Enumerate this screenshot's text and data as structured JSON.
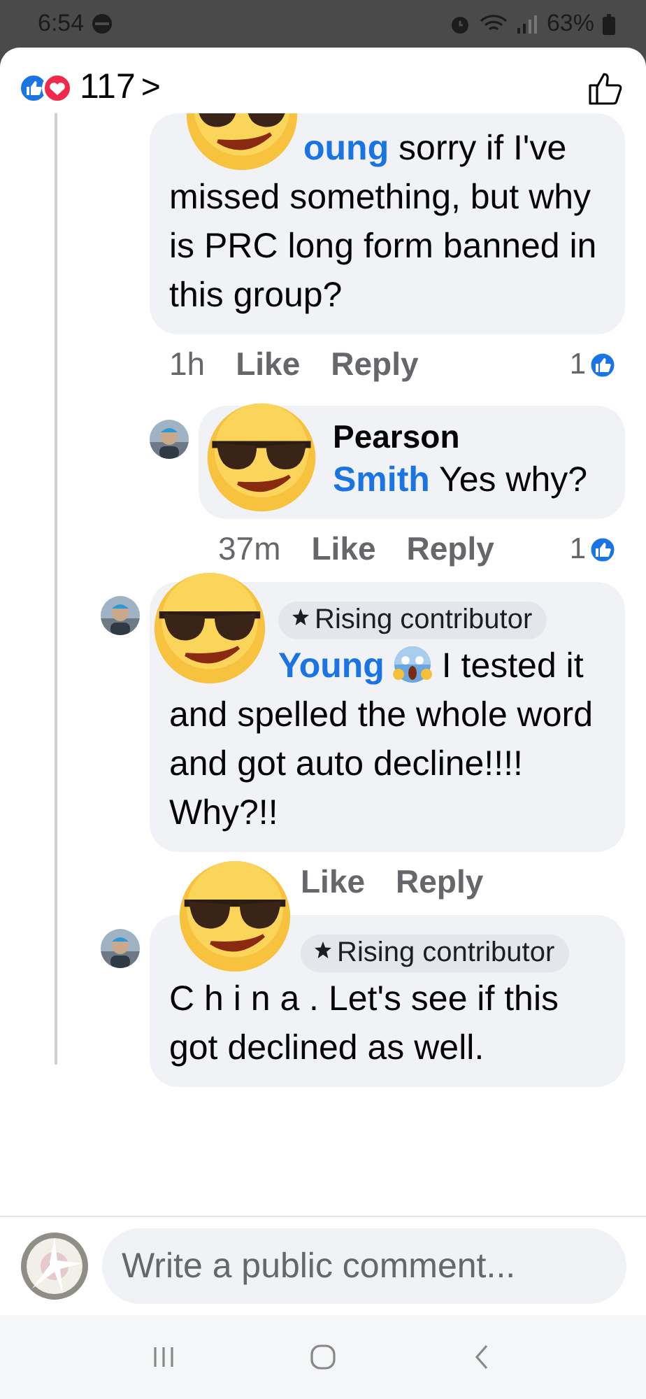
{
  "status_bar": {
    "time": "6:54",
    "battery": "63%"
  },
  "header": {
    "reaction_count": "117",
    "chevron": ">"
  },
  "comments": [
    {
      "sticker": true,
      "body": [
        {
          "kind": "mention",
          "text": "oung"
        },
        {
          "kind": "text",
          "text": " sorry if I've missed something, but why is PRC long form banned in this group?"
        }
      ],
      "meta": {
        "time": "1h",
        "like": "Like",
        "reply": "Reply",
        "reactions": "1"
      },
      "children": [
        {
          "sticker": true,
          "avatar": {
            "kind": "picture"
          },
          "author": "Pearson",
          "body": [
            {
              "kind": "mention",
              "text": "Smith"
            },
            {
              "kind": "text",
              "text": " Yes why?"
            }
          ],
          "meta": {
            "time": "37m",
            "like": "Like",
            "reply": "Reply",
            "reactions": "1"
          }
        }
      ]
    },
    {
      "sticker": true,
      "avatar": {
        "kind": "picture"
      },
      "badge": "Rising contributor",
      "body": [
        {
          "kind": "mention",
          "text": "Young"
        },
        {
          "kind": "emoji"
        },
        {
          "kind": "text",
          "text": " I tested it and spelled the whole word and got auto decline!!!!  Why?!!"
        }
      ],
      "meta": {
        "like": "Like",
        "reply": "Reply"
      }
    },
    {
      "sticker": true,
      "avatar": {
        "kind": "picture"
      },
      "badge": "Rising contributor",
      "body": [
        {
          "kind": "text",
          "text": "C h i n a . Let's see if this got declined as well."
        }
      ]
    }
  ],
  "composer": {
    "placeholder": "Write a public comment..."
  }
}
